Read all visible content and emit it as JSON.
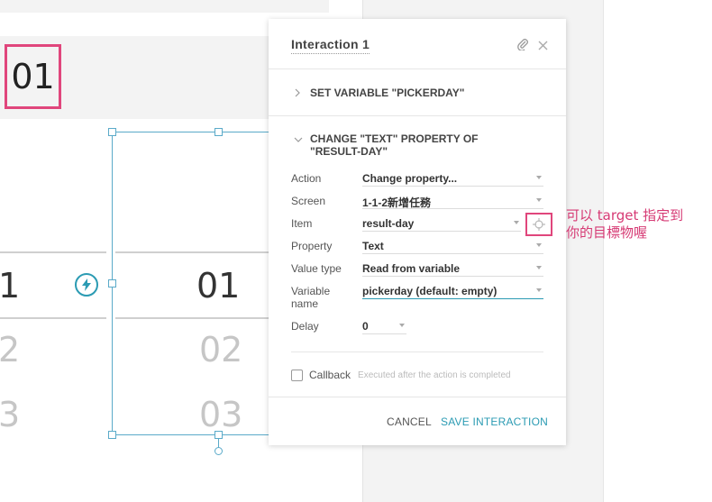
{
  "canvas": {
    "highlighted_value": "01",
    "left_column": [
      "1",
      "2",
      "3"
    ],
    "picker_column": [
      "01",
      "02",
      "03"
    ]
  },
  "panel": {
    "title": "Interaction 1",
    "section1_title": "SET VARIABLE \"PICKERDAY\"",
    "section2_title": "CHANGE \"TEXT\" PROPERTY OF \"RESULT-DAY\"",
    "fields": {
      "action": {
        "label": "Action",
        "value": "Change property..."
      },
      "screen": {
        "label": "Screen",
        "value": "1-1-2新增任務"
      },
      "item": {
        "label": "Item",
        "value": "result-day"
      },
      "property": {
        "label": "Property",
        "value": "Text"
      },
      "value_type": {
        "label": "Value type",
        "value": "Read from variable"
      },
      "variable_name": {
        "label": "Variable name",
        "value": "pickerday (default: empty)"
      },
      "delay": {
        "label": "Delay",
        "value": "0"
      }
    },
    "callback_label": "Callback",
    "callback_hint": "Executed after the action is completed",
    "cancel_label": "CANCEL",
    "save_label": "SAVE INTERACTION"
  },
  "annotation": {
    "line1": "可以 target 指定到",
    "line2": "你的目標物喔"
  },
  "colors": {
    "accent": "#2b9bb3",
    "highlight": "#e0467c"
  }
}
